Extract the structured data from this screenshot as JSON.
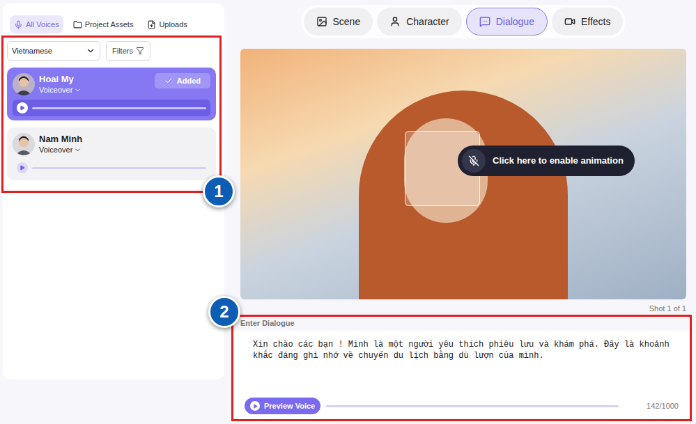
{
  "sidebar_tabs": [
    {
      "label": "All Voices",
      "selected": true
    },
    {
      "label": "Project Assets",
      "selected": false
    },
    {
      "label": "Uploads",
      "selected": false
    }
  ],
  "language_select": {
    "value": "Vietnamese"
  },
  "filters_button": "Filters",
  "voices": [
    {
      "name": "Hoai My",
      "type": "Voiceover",
      "selected": true,
      "added": true,
      "added_label": "Added",
      "level": 0
    },
    {
      "name": "Nam Minh",
      "type": "Voiceover",
      "selected": false,
      "added": false,
      "added_label": "",
      "level": 0
    }
  ],
  "annotations": [
    "1",
    "2"
  ],
  "top_tabs": [
    {
      "label": "Scene",
      "selected": false
    },
    {
      "label": "Character",
      "selected": false
    },
    {
      "label": "Dialogue",
      "selected": true
    },
    {
      "label": "Effects",
      "selected": false
    }
  ],
  "preview": {
    "overlay": "Click here to enable animation",
    "shot": "Shot 1 of 1"
  },
  "dialogue": {
    "label": "Enter Dialogue",
    "text": "Xin chào các bạn ! Mình là một người yêu thích phiêu lưu và khám phá. Đây là khoảnh khắc đáng ghi nhớ về chuyến du lịch bằng dù lượn của mình.",
    "preview_button": "Preview Voice",
    "counter": "142/1000"
  }
}
